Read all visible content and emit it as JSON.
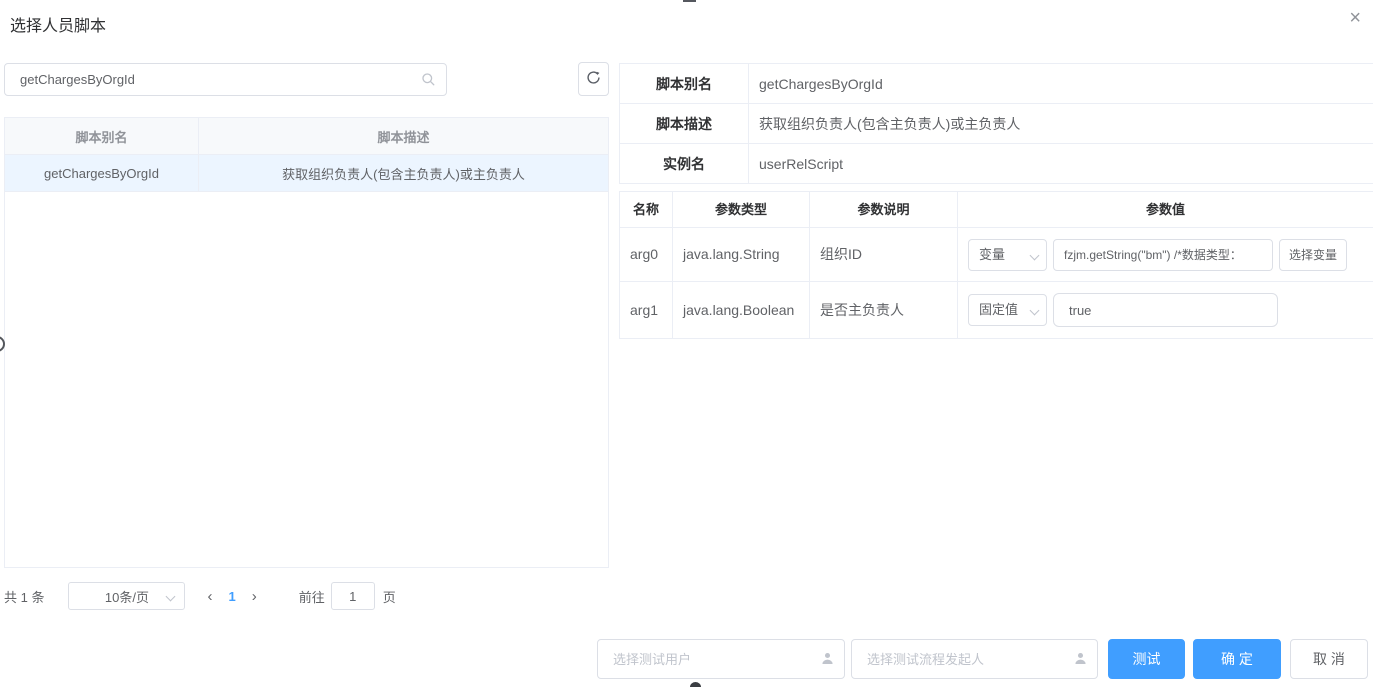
{
  "colors": {
    "primary": "#409eff",
    "selected_row_bg": "#ecf5ff",
    "input_border": "#dcdfe6",
    "table_line": "#ebeef5",
    "placeholder": "#c0c4cc"
  },
  "dialog": {
    "title": "选择人员脚本"
  },
  "icons": {
    "close": "×",
    "search": "magnifier-icon",
    "refresh": "refresh-arrow-icon",
    "chevron": "chevron-down-icon",
    "person": "person-silhouette-icon",
    "prev": "‹",
    "next": "›"
  },
  "left_panel": {
    "search_value": "getChargesByOrgId",
    "table": {
      "headers": [
        "脚本别名",
        "脚本描述"
      ],
      "rows": [
        {
          "alias": "getChargesByOrgId",
          "desc": "获取组织负责人(包含主负责人)或主负责人"
        }
      ]
    },
    "pagination": {
      "total": "共 1 条",
      "page_size": "10条/页",
      "page": "1",
      "goto_label": "前往",
      "goto_value": "1",
      "unit": "页"
    }
  },
  "detail": {
    "fields": [
      {
        "label": "脚本别名",
        "value": "getChargesByOrgId"
      },
      {
        "label": "脚本描述",
        "value": "获取组织负责人(包含主负责人)或主负责人"
      },
      {
        "label": "实例名",
        "value": "userRelScript"
      }
    ],
    "params_table": {
      "headers": [
        "名称",
        "参数类型",
        "参数说明",
        "参数值"
      ],
      "rows": [
        {
          "name": "arg0",
          "type": "java.lang.String",
          "desc": "组织ID",
          "mode": "变量",
          "value": "fzjm.getString(\"bm\") /*数据类型：",
          "action": "选择变量"
        },
        {
          "name": "arg1",
          "type": "java.lang.Boolean",
          "desc": "是否主负责人",
          "mode": "固定值",
          "value": "true"
        }
      ]
    }
  },
  "footer": {
    "test_user_placeholder": "选择测试用户",
    "initiator_placeholder": "选择测试流程发起人",
    "test": "测试",
    "confirm": "确 定",
    "cancel": "取 消"
  }
}
